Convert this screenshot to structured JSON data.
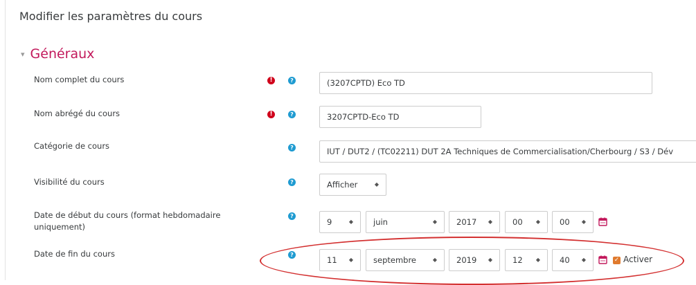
{
  "page_title": "Modifier les paramètres du cours",
  "section": {
    "title": "Généraux"
  },
  "fields": {
    "fullname": {
      "label": "Nom complet du cours",
      "value": "(3207CPTD) Eco TD"
    },
    "shortname": {
      "label": "Nom abrégé du cours",
      "value": "3207CPTD-Eco TD"
    },
    "category": {
      "label": "Catégorie de cours",
      "value": "IUT / DUT2 / (TC02211) DUT 2A Techniques de Commercialisation/Cherbourg / S3 / Dév"
    },
    "visibility": {
      "label": "Visibilité du cours",
      "value": "Afficher"
    },
    "startdate": {
      "label": "Date de début du cours (format hebdomadaire uniquement)",
      "day": "9",
      "month": "juin",
      "year": "2017",
      "hour": "00",
      "minute": "00"
    },
    "enddate": {
      "label": "Date de fin du cours",
      "day": "11",
      "month": "septembre",
      "year": "2019",
      "hour": "12",
      "minute": "40",
      "enable_label": "Activer",
      "enabled": true
    }
  },
  "icons": {
    "required": "exclamation-icon",
    "help": "question-icon",
    "calendar": "calendar-icon",
    "select_arrow": "updown-arrow-icon"
  },
  "colors": {
    "section_title": "#c2185b",
    "required": "#d0021b",
    "help": "#1f9bd1",
    "calendar": "#c2185b",
    "checkbox": "#e07a2e",
    "highlight": "#d32f2f"
  }
}
